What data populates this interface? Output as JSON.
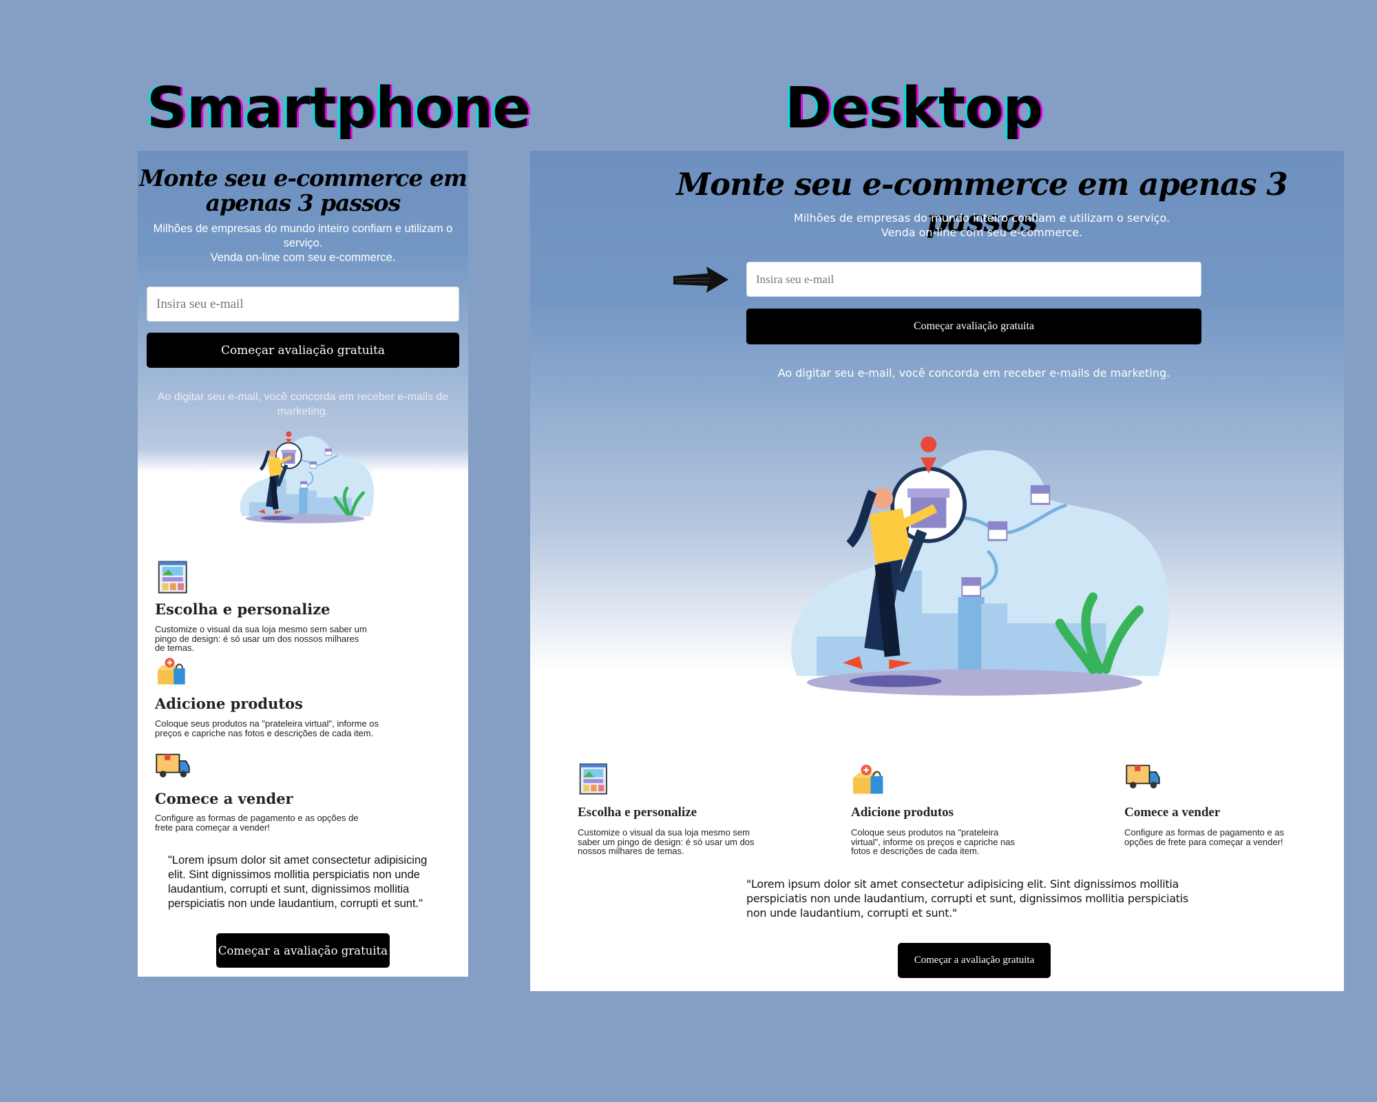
{
  "labels": {
    "smartphone": "Smartphone",
    "desktop": "Desktop"
  },
  "hero": {
    "title": "Monte seu e-commerce em apenas 3 passos",
    "title_mobile_line1": "Monte seu e-commerce em",
    "title_mobile_line2": "apenas 3 passos",
    "subtitle_line1": "Milhões de empresas do mundo inteiro confiam e utilizam o serviço.",
    "subtitle_line2": "Venda on-line com seu e-commerce.",
    "email_placeholder": "Insira seu e-mail",
    "cta_label": "Começar avaliação gratuita",
    "disclaimer": "Ao digitar seu e-mail, você concorda em receber e-mails de marketing."
  },
  "features": [
    {
      "icon": "website-template-icon",
      "title": "Escolha e personalize",
      "description": "Customize o visual da sua loja mesmo sem saber um pingo de design: é só usar um dos nossos milhares de temas."
    },
    {
      "icon": "add-product-box-icon",
      "title": "Adicione produtos",
      "description": "Coloque seus produtos na \"prateleira virtual\", informe os preços e capriche nas fotos e descrições de cada item."
    },
    {
      "icon": "delivery-truck-icon",
      "title": "Comece a vender",
      "description": "Configure as formas de pagamento e as opções de frete para começar a vender!"
    }
  ],
  "testimonial": {
    "quote": "\"Lorem ipsum dolor sit amet consectetur adipisicing elit. Sint dignissimos mollitia perspiciatis non unde laudantium, corrupti et sunt, dignissimos mollitia perspiciatis non unde laudantium, corrupti et sunt.\""
  },
  "footer_cta": {
    "label": "Começar a avaliação gratuita"
  }
}
